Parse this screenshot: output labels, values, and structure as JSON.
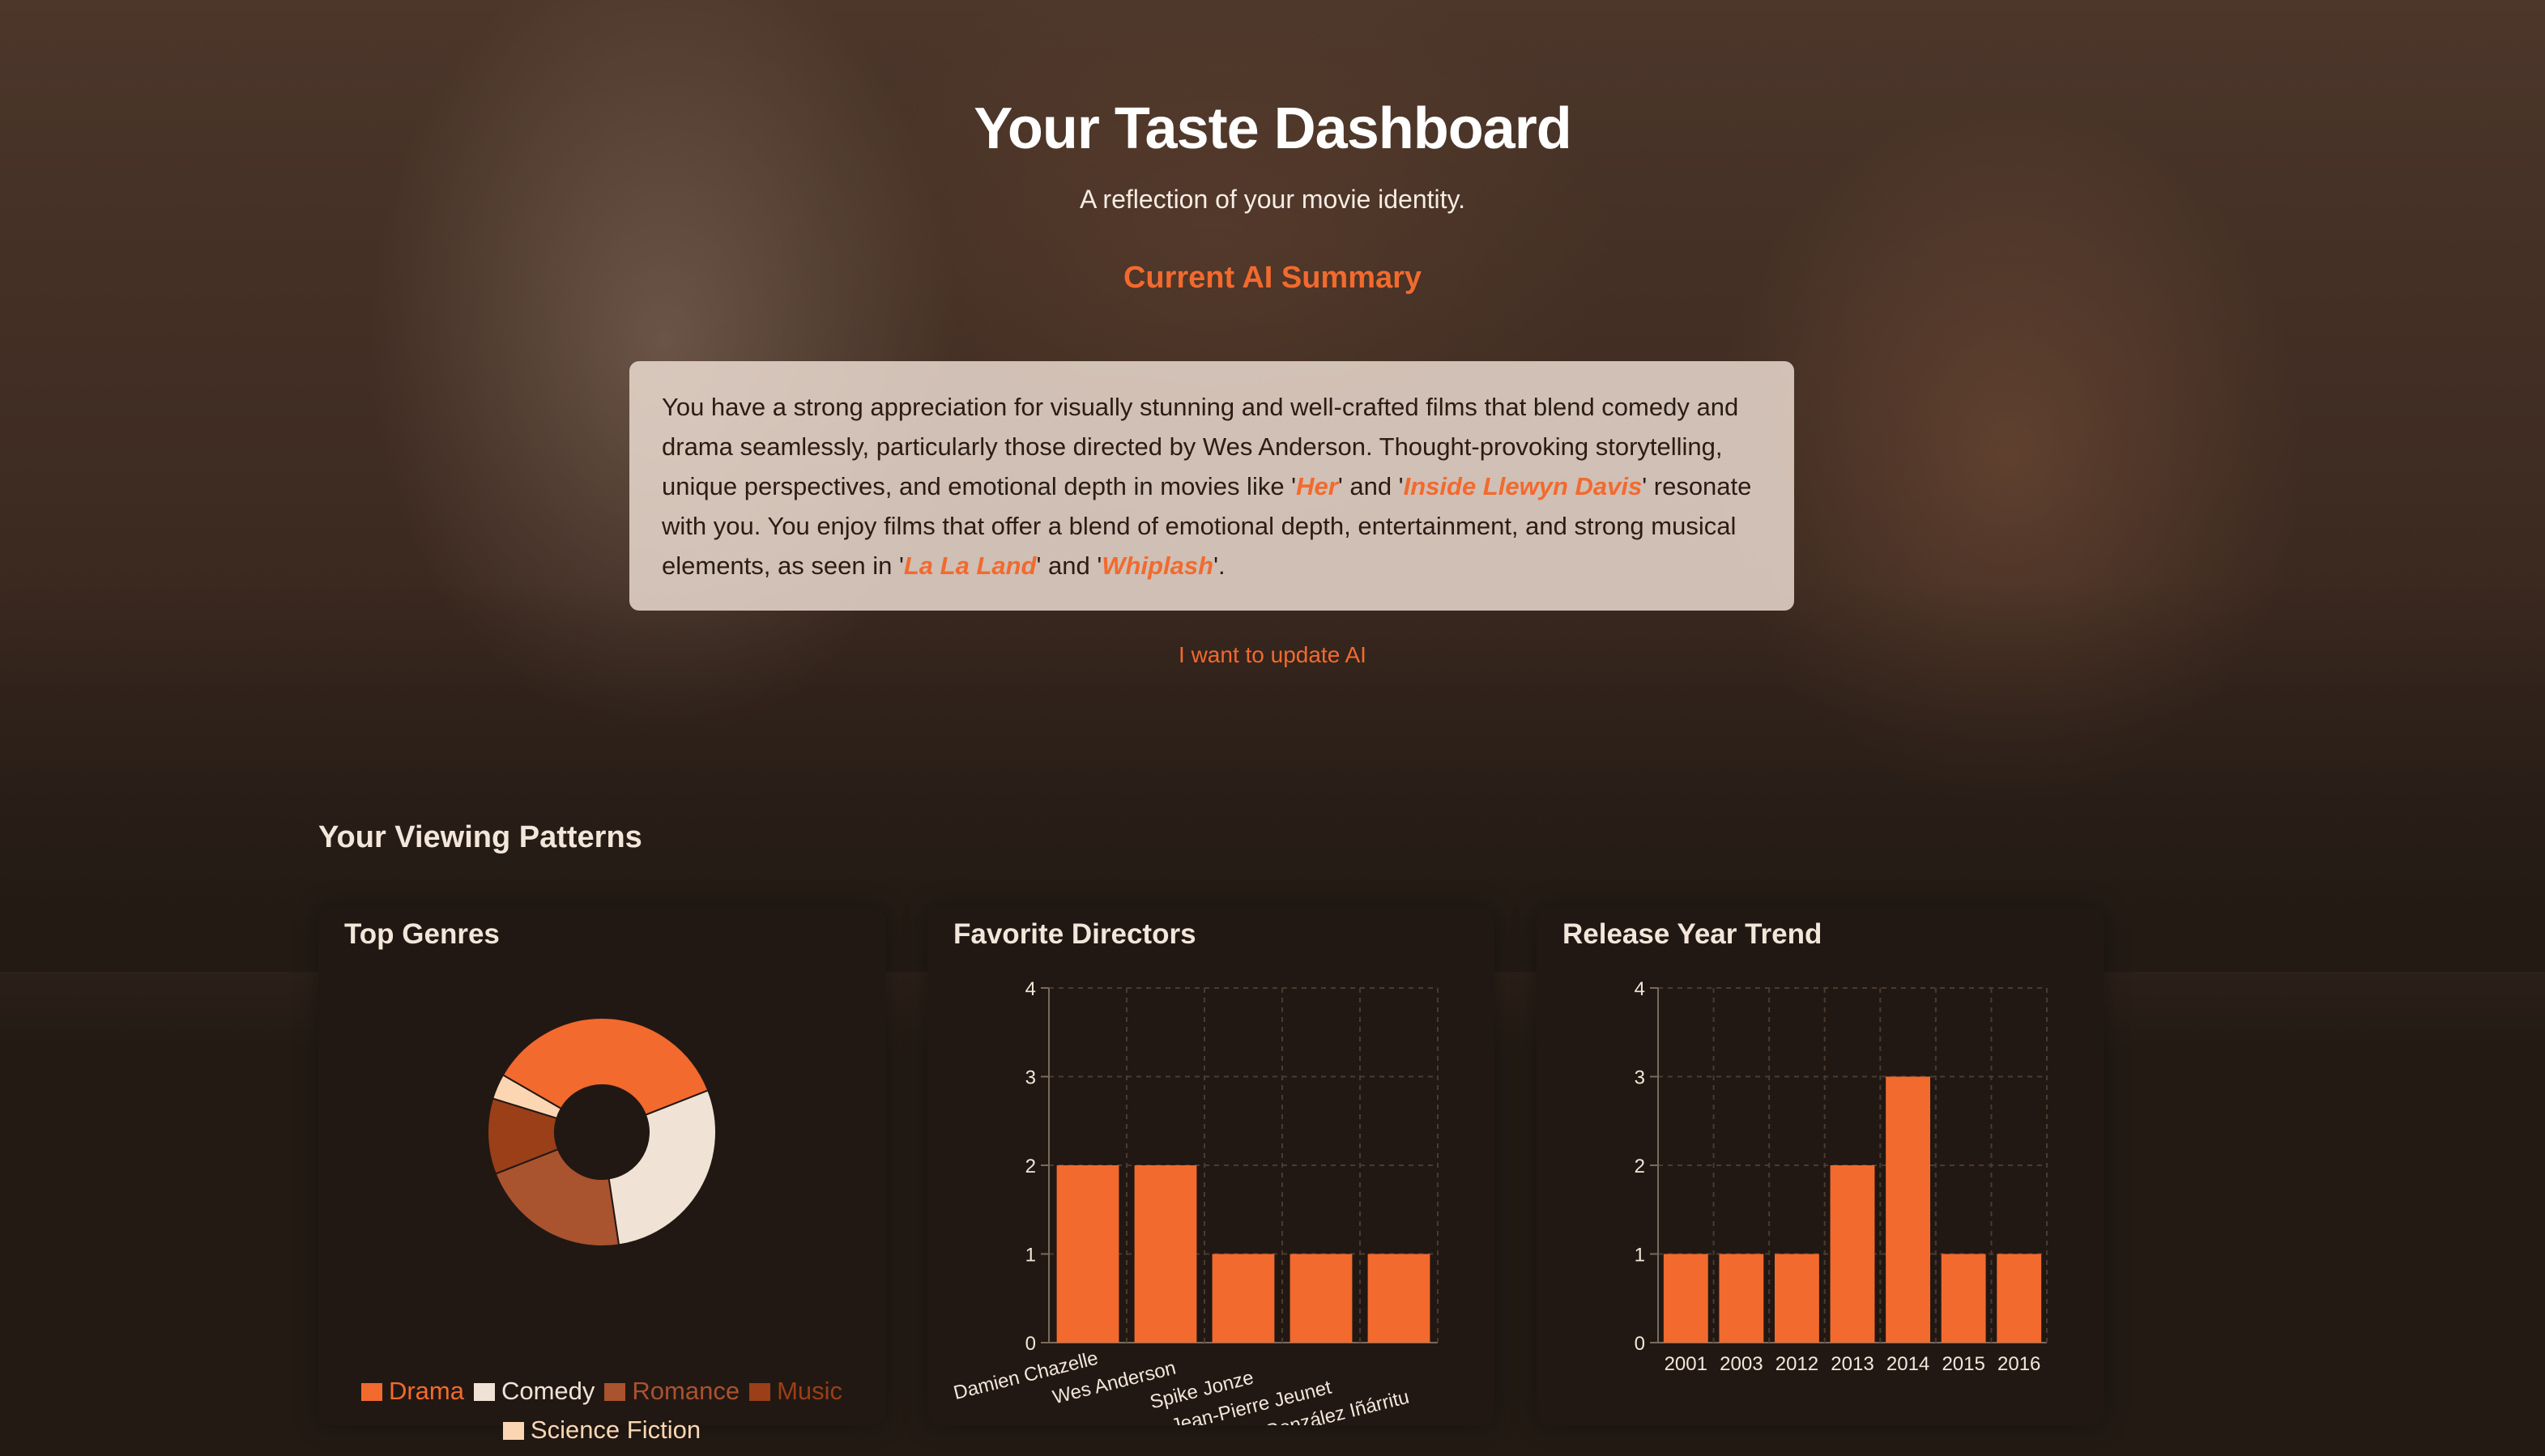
{
  "header": {
    "title": "Your Taste Dashboard",
    "subtitle": "A reflection of your movie identity.",
    "ai_heading": "Current AI Summary"
  },
  "summary": {
    "parts": [
      "You have a strong appreciation for visually stunning and well-crafted films that blend comedy and drama seamlessly, particularly those directed by Wes Anderson. Thought-provoking storytelling, unique perspectives, and emotional depth in movies like '",
      "Her",
      "' and '",
      "Inside Llewyn Davis",
      "' resonate with you. You enjoy films that offer a blend of emotional depth, entertainment, and strong musical elements, as seen in '",
      "La La Land",
      "' and '",
      "Whiplash",
      "'."
    ]
  },
  "update_link": "I want to update AI",
  "patterns": {
    "title": "Your Viewing Patterns"
  },
  "colors": {
    "accent": "#f26a2e",
    "background": "#231a14"
  },
  "chart_data": [
    {
      "type": "pie",
      "title": "Top Genres",
      "donut": true,
      "categories": [
        "Drama",
        "Comedy",
        "Romance",
        "Music",
        "Science Fiction"
      ],
      "values": [
        5,
        4,
        3,
        1.5,
        0.5
      ],
      "colors": [
        "#f26a2e",
        "#f0e2d5",
        "#a9532f",
        "#9a3f17",
        "#fcd6b3"
      ],
      "legend_position": "bottom"
    },
    {
      "type": "bar",
      "title": "Favorite Directors",
      "categories": [
        "Damien Chazelle",
        "Wes Anderson",
        "Spike Jonze",
        "Jean-Pierre Jeunet",
        "Alejandro González Iñárritu"
      ],
      "values": [
        2,
        2,
        1,
        1,
        1
      ],
      "ylim": [
        0,
        4
      ],
      "yticks": [
        0,
        1,
        2,
        3,
        4
      ],
      "grid": true,
      "color": "#f26a2e"
    },
    {
      "type": "bar",
      "title": "Release Year Trend",
      "categories": [
        "2001",
        "2003",
        "2012",
        "2013",
        "2014",
        "2015",
        "2016"
      ],
      "values": [
        1,
        1,
        1,
        2,
        3,
        1,
        1
      ],
      "ylim": [
        0,
        4
      ],
      "yticks": [
        0,
        1,
        2,
        3,
        4
      ],
      "grid": true,
      "color": "#f26a2e"
    }
  ]
}
